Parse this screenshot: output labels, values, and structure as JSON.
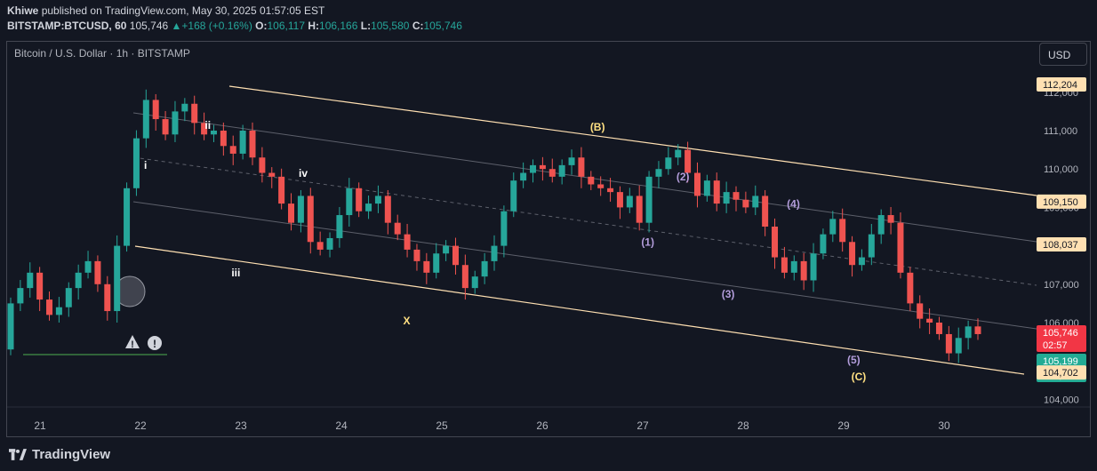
{
  "header": {
    "author": "Khiwe",
    "published_text": "published on TradingView.com, May 30, 2025 01:57:05 EST",
    "symbol": "BITSTAMP:BTCUSD, 60",
    "last": "105,746",
    "change": "+168 (+0.16%)",
    "o_label": "O:",
    "o": "106,117",
    "h_label": "H:",
    "h": "106,166",
    "l_label": "L:",
    "l": "105,580",
    "c_label": "C:",
    "c": "105,746"
  },
  "chart_title": "Bitcoin / U.S. Dollar · 1h · BITSTAMP",
  "currency_button": "USD",
  "footer": {
    "brand": "TradingView"
  },
  "colors": {
    "up": "#26a69a",
    "down": "#ef5350",
    "channel": "#ffe0b2",
    "bg": "#131722"
  },
  "chart_data": {
    "type": "candlestick",
    "ylim": [
      104000,
      112400
    ],
    "price_ticks": [
      "112,000",
      "111,000",
      "110,000",
      "109,000",
      "108,000",
      "107,000",
      "106,000",
      "105,000",
      "104,000"
    ],
    "x_ticks": [
      "21",
      "22",
      "23",
      "24",
      "25",
      "26",
      "27",
      "28",
      "29",
      "30"
    ],
    "price_labels": [
      {
        "text": "112,204",
        "value": 112204,
        "kind": "line"
      },
      {
        "text": "109,150",
        "value": 109150,
        "kind": "line"
      },
      {
        "text": "108,037",
        "value": 108037,
        "kind": "line"
      },
      {
        "text": "105,746",
        "value": 105746,
        "kind": "last"
      },
      {
        "text": "02:57",
        "value": 105746,
        "kind": "countdown"
      },
      {
        "text": "105,199",
        "value": 105199,
        "kind": "green"
      },
      {
        "text": "105,199",
        "value": 105199,
        "kind": "green2"
      },
      {
        "text": "104,702",
        "value": 104702,
        "kind": "line"
      }
    ],
    "wave_labels": [
      {
        "text": "i",
        "day": 22.05,
        "price": 110000,
        "color": "#ffffff"
      },
      {
        "text": "ii",
        "day": 22.67,
        "price": 111050,
        "color": "#ffffff"
      },
      {
        "text": "iii",
        "day": 22.95,
        "price": 107200,
        "color": "#ffffff"
      },
      {
        "text": "iv",
        "day": 23.62,
        "price": 109800,
        "color": "#ffffff"
      },
      {
        "text": "X",
        "day": 24.65,
        "price": 105950,
        "color": "#ffe082"
      },
      {
        "text": "(B)",
        "day": 26.55,
        "price": 111000,
        "color": "#ffe082"
      },
      {
        "text": "(1)",
        "day": 27.05,
        "price": 108000,
        "color": "#b39ddb"
      },
      {
        "text": "(2)",
        "day": 27.4,
        "price": 109700,
        "color": "#b39ddb"
      },
      {
        "text": "(3)",
        "day": 27.85,
        "price": 106650,
        "color": "#b39ddb"
      },
      {
        "text": "(4)",
        "day": 28.5,
        "price": 109000,
        "color": "#b39ddb"
      },
      {
        "text": "(5)",
        "day": 29.1,
        "price": 104930,
        "color": "#b39ddb"
      },
      {
        "text": "(C)",
        "day": 29.15,
        "price": 104500,
        "color": "#ffe082"
      }
    ],
    "close_series": [
      106500,
      106900,
      107300,
      106600,
      106200,
      106400,
      106900,
      107300,
      107600,
      107000,
      106300,
      108000,
      109500,
      110800,
      111800,
      111300,
      110900,
      111500,
      111700,
      111200,
      110900,
      111000,
      110600,
      110400,
      111000,
      110300,
      109900,
      109800,
      109100,
      108600,
      109300,
      108100,
      107900,
      108200,
      108800,
      109500,
      108900,
      109100,
      109300,
      108600,
      108300,
      107900,
      107600,
      107300,
      107800,
      108000,
      107500,
      106900,
      107200,
      107600,
      108000,
      108900,
      109700,
      109900,
      110100,
      110000,
      109800,
      110100,
      110300,
      109800,
      109600,
      109500,
      109400,
      109000,
      109300,
      108600,
      109800,
      110000,
      110300,
      110500,
      109900,
      109300,
      109700,
      109100,
      109400,
      109200,
      109000,
      109300,
      108500,
      107700,
      107300,
      107600,
      107100,
      107800,
      108300,
      108700,
      108100,
      107500,
      107700,
      108300,
      108800,
      108600,
      107300,
      106500,
      106100,
      106000,
      105700,
      105200,
      105600,
      105900,
      105700
    ]
  }
}
